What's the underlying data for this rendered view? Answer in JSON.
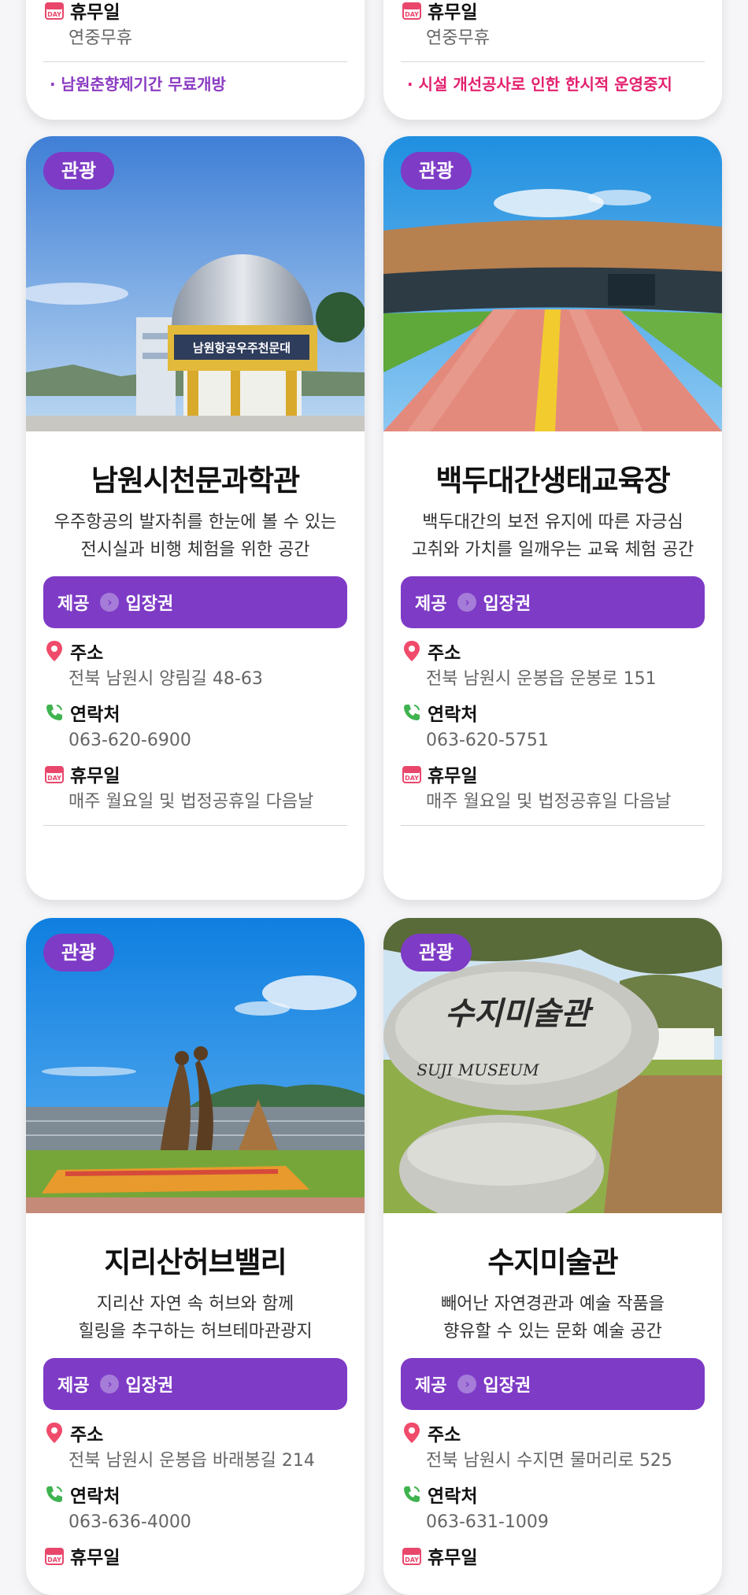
{
  "colors": {
    "accent": "#7e3bc6",
    "notice1": "#8a3bc2",
    "notice2": "#e3206e"
  },
  "labels": {
    "address": "주소",
    "contact": "연락처",
    "holiday": "휴무일",
    "provide": "제공",
    "ticket": "입장권",
    "category": "관광"
  },
  "top_cards": [
    {
      "holiday": "연중무휴",
      "notice": "· 남원춘향제기간 무료개방"
    },
    {
      "holiday": "연중무휴",
      "notice": "· 시설 개선공사로 인한 한시적 운영중지"
    }
  ],
  "cards": [
    {
      "title": "남원시천문과학관",
      "desc1": "우주항공의 발자취를 한눈에 볼 수 있는",
      "desc2": "전시실과 비행 체험을 위한 공간",
      "address": "전북 남원시 양림길 48-63",
      "phone": "063-620-6900",
      "holiday": "매주 월요일 및 법정공휴일 다음날"
    },
    {
      "title": "백두대간생태교육장",
      "desc1": "백두대간의 보전 유지에 따른 자긍심",
      "desc2": "고취와 가치를 일깨우는 교육 체험 공간",
      "address": "전북 남원시 운봉읍 운봉로 151",
      "phone": "063-620-5751",
      "holiday": "매주 월요일 및 법정공휴일 다음날"
    },
    {
      "title": "지리산허브밸리",
      "desc1": "지리산 자연 속 허브와 함께",
      "desc2": "힐링을 추구하는 허브테마관광지",
      "address": "전북 남원시 운봉읍 바래봉길 214",
      "phone": "063-636-4000",
      "holiday": ""
    },
    {
      "title": "수지미술관",
      "desc1": "빼어난 자연경관과 예술 작품을",
      "desc2": "향유할 수 있는 문화 예술 공간",
      "address": "전북 남원시 수지면 물머리로 525",
      "phone": "063-631-1009",
      "holiday": ""
    }
  ],
  "photo_text": {
    "observatory_sign": "남원항공우주천문대",
    "museum_stone": "수지미술관",
    "museum_stone_en": "SUJI MUSEUM"
  }
}
